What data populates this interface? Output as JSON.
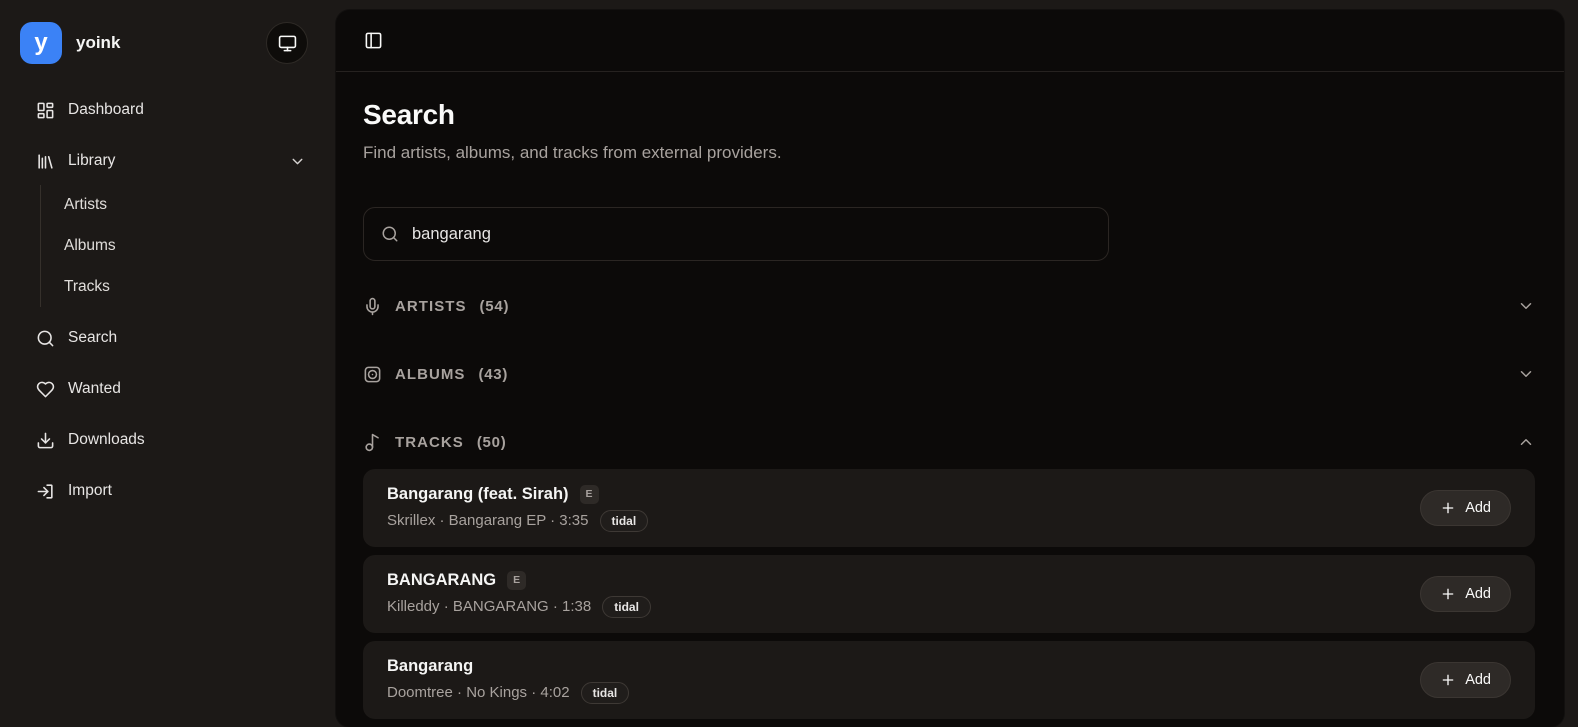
{
  "app": {
    "name": "yoink",
    "logo_letter": "y",
    "accent_color": "#3b82f6"
  },
  "sidebar": {
    "items": [
      {
        "label": "Dashboard"
      },
      {
        "label": "Library",
        "expanded": true
      },
      {
        "label": "Search"
      },
      {
        "label": "Wanted"
      },
      {
        "label": "Downloads"
      },
      {
        "label": "Import"
      }
    ],
    "library_children": [
      {
        "label": "Artists"
      },
      {
        "label": "Albums"
      },
      {
        "label": "Tracks"
      }
    ]
  },
  "page": {
    "title": "Search",
    "subtitle": "Find artists, albums, and tracks from external providers.",
    "search_value": "bangarang"
  },
  "sections": [
    {
      "label": "ARTISTS",
      "count_label": "(54)",
      "state": "collapsed"
    },
    {
      "label": "ALBUMS",
      "count_label": "(43)",
      "state": "collapsed"
    },
    {
      "label": "TRACKS",
      "count_label": "(50)",
      "state": "expanded"
    }
  ],
  "tracks": [
    {
      "title": "Bangarang (feat. Sirah)",
      "explicit_badge": "E",
      "artist": "Skrillex",
      "album": "Bangarang EP",
      "duration": "3:35",
      "meta": "Skrillex · Bangarang EP · 3:35",
      "provider": "tidal",
      "add_label": "Add"
    },
    {
      "title": "BANGARANG",
      "explicit_badge": "E",
      "artist": "Killeddy",
      "album": "BANGARANG",
      "duration": "1:38",
      "meta": "Killeddy · BANGARANG · 1:38",
      "provider": "tidal",
      "add_label": "Add"
    },
    {
      "title": "Bangarang",
      "explicit_badge": "",
      "artist": "Doomtree",
      "album": "No Kings",
      "duration": "4:02",
      "meta": "Doomtree · No Kings · 4:02",
      "provider": "tidal",
      "add_label": "Add"
    }
  ]
}
